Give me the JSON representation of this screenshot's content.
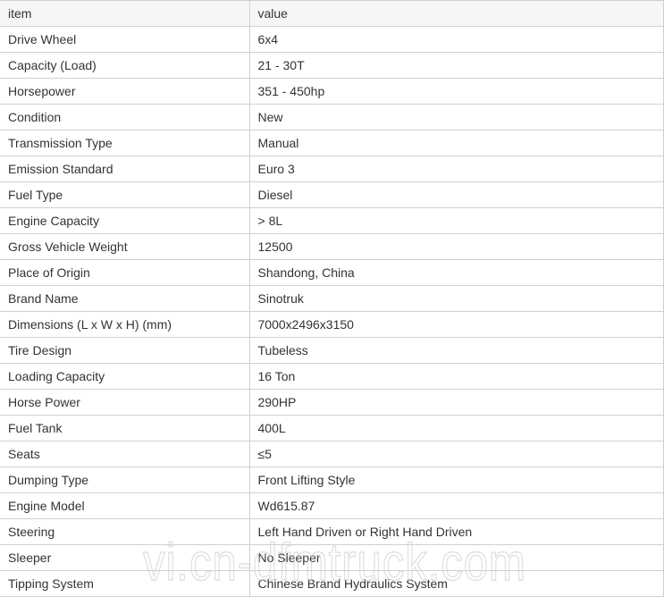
{
  "table": {
    "headers": {
      "item": "item",
      "value": "value"
    },
    "rows": [
      {
        "item": "Drive Wheel",
        "value": "6x4"
      },
      {
        "item": "Capacity (Load)",
        "value": "21 - 30T"
      },
      {
        "item": "Horsepower",
        "value": "351 - 450hp"
      },
      {
        "item": "Condition",
        "value": "New"
      },
      {
        "item": "Transmission Type",
        "value": "Manual"
      },
      {
        "item": "Emission Standard",
        "value": "Euro 3"
      },
      {
        "item": "Fuel Type",
        "value": "Diesel"
      },
      {
        "item": "Engine Capacity",
        "value": "> 8L"
      },
      {
        "item": "Gross Vehicle Weight",
        "value": "12500"
      },
      {
        "item": "Place of Origin",
        "value": "Shandong, China"
      },
      {
        "item": "Brand Name",
        "value": "Sinotruk"
      },
      {
        "item": "Dimensions (L x W x H) (mm)",
        "value": "7000x2496x3150"
      },
      {
        "item": "Tire Design",
        "value": "Tubeless"
      },
      {
        "item": "Loading Capacity",
        "value": "16 Ton"
      },
      {
        "item": "Horse Power",
        "value": "290HP"
      },
      {
        "item": "Fuel Tank",
        "value": "400L"
      },
      {
        "item": "Seats",
        "value": "≤5"
      },
      {
        "item": "Dumping Type",
        "value": "Front Lifting Style"
      },
      {
        "item": "Engine Model",
        "value": "Wd615.87"
      },
      {
        "item": "Steering",
        "value": "Left Hand Driven or Right Hand Driven"
      },
      {
        "item": "Sleeper",
        "value": "No Sleeper"
      },
      {
        "item": "Tipping System",
        "value": "Chinese Brand Hydraulics System"
      }
    ]
  },
  "watermark": "vi.cn-dfmtruck.com",
  "colors": {
    "header_bg": "#f5f6f8",
    "border": "#d0d0d0",
    "text": "#333333"
  }
}
